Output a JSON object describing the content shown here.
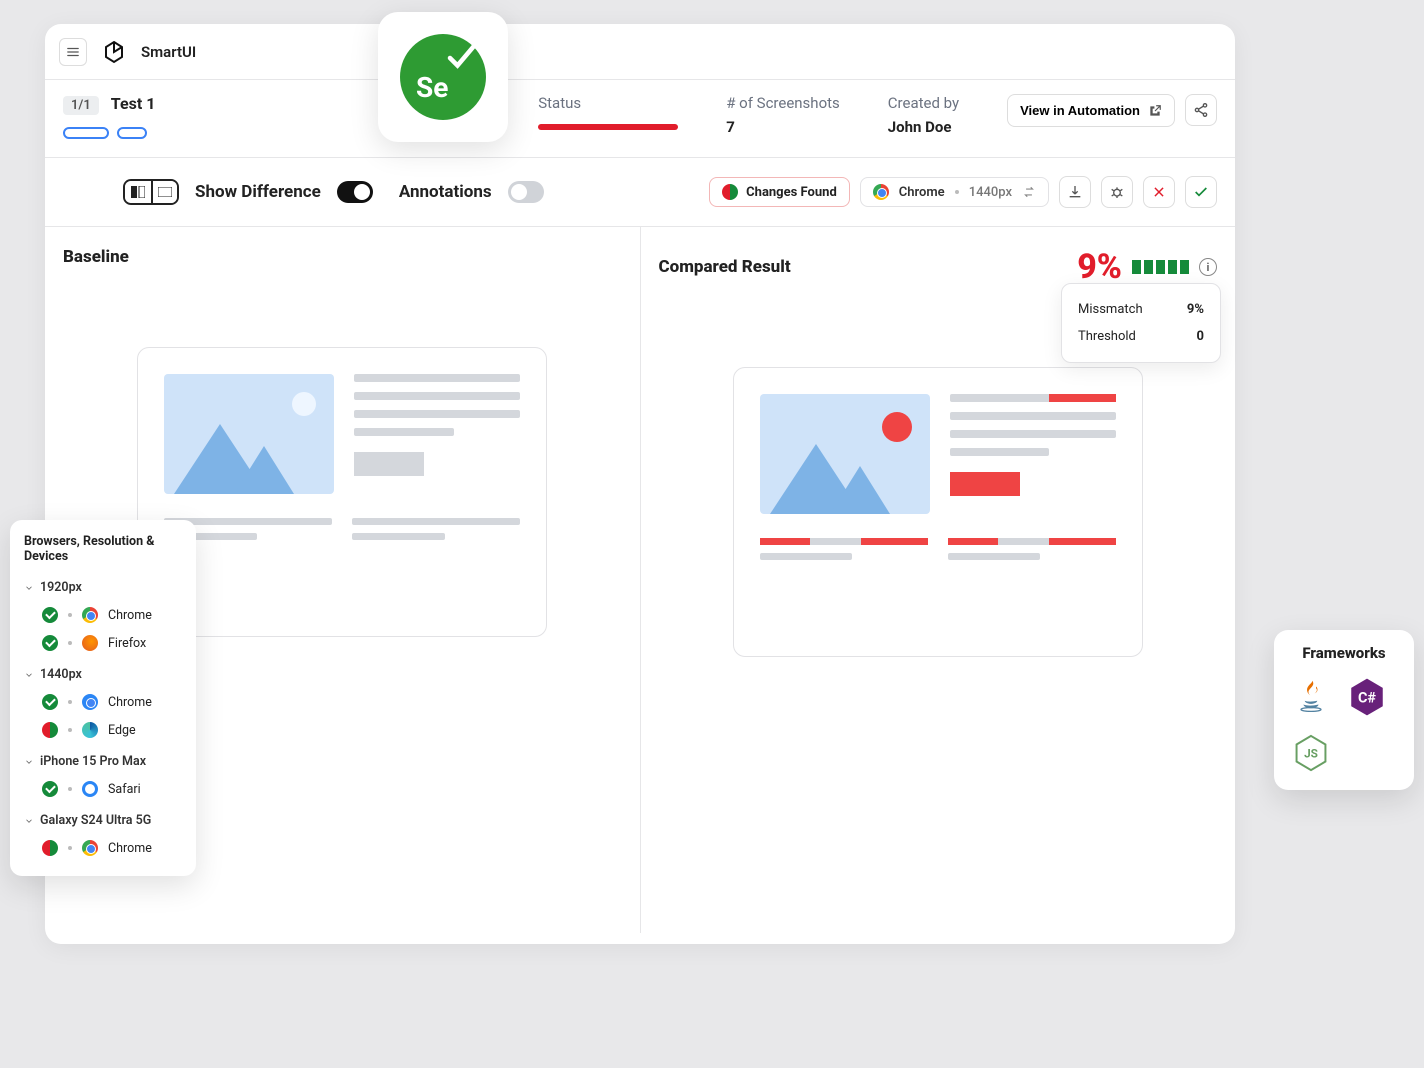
{
  "app": {
    "title": "SmartUI"
  },
  "test": {
    "counter": "1/1",
    "name": "Test 1",
    "status_label": "Status",
    "screenshots_label": "# of Screenshots",
    "screenshots_value": "7",
    "created_by_label": "Created by",
    "created_by_value": "John Doe",
    "view_in_automation": "View in Automation"
  },
  "toolbar": {
    "show_difference": "Show Difference",
    "annotations": "Annotations",
    "changes_found": "Changes Found",
    "browser": "Chrome",
    "resolution": "1440px"
  },
  "compare": {
    "baseline_title": "Baseline",
    "compared_title": "Compared Result",
    "mismatch_pct": "9%"
  },
  "tooltip": {
    "mismatch_label": "Missmatch",
    "mismatch_value": "9%",
    "threshold_label": "Threshold",
    "threshold_value": "0"
  },
  "browsers_panel": {
    "title": "Browsers, Resolution & Devices",
    "groups": [
      {
        "label": "1920px",
        "items": [
          {
            "status": "ok",
            "browser": "Chrome",
            "icon": "chrome"
          },
          {
            "status": "ok",
            "browser": "Firefox",
            "icon": "firefox"
          }
        ]
      },
      {
        "label": "1440px",
        "items": [
          {
            "status": "ok",
            "browser": "Chrome",
            "icon": "chrome"
          },
          {
            "status": "diff",
            "browser": "Edge",
            "icon": "edge"
          }
        ]
      },
      {
        "label": "iPhone 15 Pro Max",
        "items": [
          {
            "status": "ok",
            "browser": "Safari",
            "icon": "safari"
          }
        ]
      },
      {
        "label": "Galaxy S24 Ultra 5G",
        "items": [
          {
            "status": "diff",
            "browser": "Chrome",
            "icon": "chrome"
          }
        ]
      }
    ]
  },
  "frameworks_panel": {
    "title": "Frameworks",
    "items": [
      "java",
      "csharp",
      "nodejs"
    ]
  },
  "colors": {
    "red": "#e11d2b",
    "green": "#158a3a",
    "selenium": "#2e9b33"
  }
}
